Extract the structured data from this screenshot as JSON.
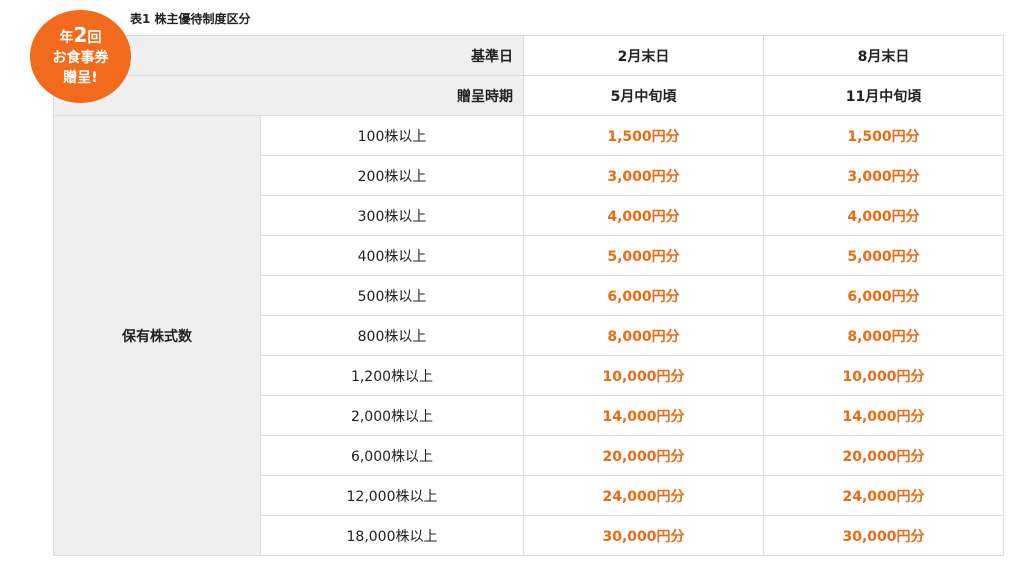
{
  "caption": "表1 株主優待制度区分",
  "badge": {
    "prefix": "年",
    "number": "2",
    "suffix": "回",
    "line2": "お食事券",
    "line3": "贈呈!"
  },
  "header": {
    "date_label": "基準日",
    "period_label": "贈呈時期",
    "columns": [
      {
        "date": "2月末日",
        "period": "5月中旬頃"
      },
      {
        "date": "8月末日",
        "period": "11月中旬頃"
      }
    ]
  },
  "group_label": "保有株式数",
  "rows": [
    {
      "shares": "100株以上",
      "feb": "1,500円分",
      "aug": "1,500円分"
    },
    {
      "shares": "200株以上",
      "feb": "3,000円分",
      "aug": "3,000円分"
    },
    {
      "shares": "300株以上",
      "feb": "4,000円分",
      "aug": "4,000円分"
    },
    {
      "shares": "400株以上",
      "feb": "5,000円分",
      "aug": "5,000円分"
    },
    {
      "shares": "500株以上",
      "feb": "6,000円分",
      "aug": "6,000円分"
    },
    {
      "shares": "800株以上",
      "feb": "8,000円分",
      "aug": "8,000円分"
    },
    {
      "shares": "1,200株以上",
      "feb": "10,000円分",
      "aug": "10,000円分"
    },
    {
      "shares": "2,000株以上",
      "feb": "14,000円分",
      "aug": "14,000円分"
    },
    {
      "shares": "6,000株以上",
      "feb": "20,000円分",
      "aug": "20,000円分"
    },
    {
      "shares": "12,000株以上",
      "feb": "24,000円分",
      "aug": "24,000円分"
    },
    {
      "shares": "18,000株以上",
      "feb": "30,000円分",
      "aug": "30,000円分"
    }
  ],
  "colors": {
    "accent": "#f26a1b",
    "value_text": "#ec6a10",
    "header_bg": "#efefef"
  }
}
